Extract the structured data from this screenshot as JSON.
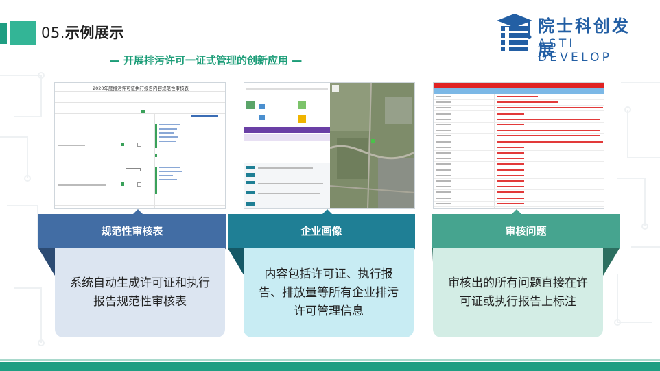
{
  "header": {
    "section_number": "05.",
    "section_title": "示例展示",
    "subtitle": "— 开展排污许可一证式管理的创新应用 —"
  },
  "logo": {
    "cn": "院士科创发展",
    "en": "ASTI DEVELOP"
  },
  "panels": [
    {
      "bar_label": "规范性审核表",
      "description": "系统自动生成许可证和执行报告规范性审核表",
      "screenshot_title": "2020年度排污许可证执行报告内容规范性审核表"
    },
    {
      "bar_label": "企业画像",
      "description": "内容包括许可证、执行报告、排放量等所有企业排污许可管理信息"
    },
    {
      "bar_label": "审核问题",
      "description": "审核出的所有问题直接在许可证或执行报告上标注"
    }
  ],
  "colors": {
    "accent_green": "#1f9e82",
    "bar_blue": "#426da4",
    "bar_teal": "#1f7f95",
    "bar_green": "#46a48f",
    "logo_blue": "#235fa4"
  }
}
